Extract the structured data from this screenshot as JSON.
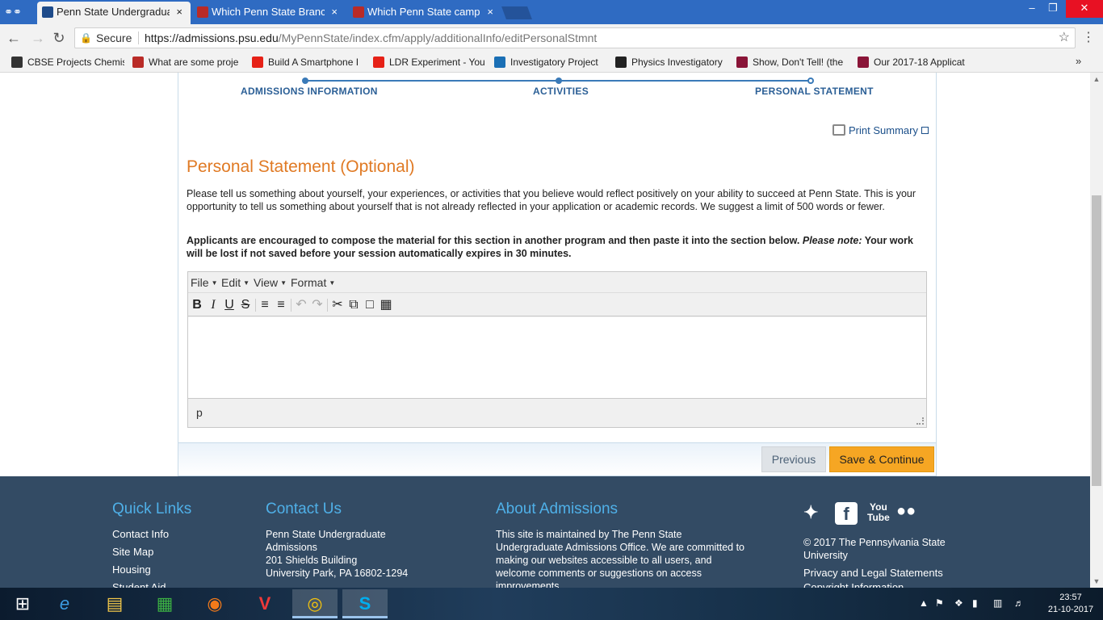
{
  "browser": {
    "incognito_icon": "incognito-icon",
    "tabs": [
      {
        "title": "Penn State Undergraduat",
        "close": "×",
        "favicon_color": "#1e4b8a",
        "active": true
      },
      {
        "title": "Which Penn State Branch",
        "close": "×",
        "favicon_color": "#b92b27",
        "active": false
      },
      {
        "title": "Which Penn State campu",
        "close": "×",
        "favicon_color": "#b92b27",
        "active": false
      }
    ],
    "window_controls": {
      "minimize": "–",
      "restore": "❐",
      "close": "✕"
    },
    "secure_label": "Secure",
    "url_host": "https://admissions.psu.edu",
    "url_path": "/MyPennState/index.cfm/apply/additionalInfo/editPersonalStmnt",
    "bookmarks": [
      {
        "label": "CBSE Projects Chemis",
        "favicon_color": "#333333"
      },
      {
        "label": "What are some proje",
        "favicon_color": "#b92b27"
      },
      {
        "label": "Build A Smartphone I",
        "favicon_color": "#e62117"
      },
      {
        "label": "LDR Experiment - You",
        "favicon_color": "#e62117"
      },
      {
        "label": "Investigatory Project",
        "favicon_color": "#1a6fb5"
      },
      {
        "label": "Physics Investigatory",
        "favicon_color": "#222222"
      },
      {
        "label": "Show, Don't Tell! (the",
        "favicon_color": "#8a1538"
      },
      {
        "label": "Our 2017-18 Applicat",
        "favicon_color": "#8a1538"
      }
    ],
    "bookmarks_more": "»"
  },
  "progress": {
    "steps": [
      "ADMISSIONS INFORMATION",
      "ACTIVITIES",
      "PERSONAL STATEMENT"
    ]
  },
  "print_summary": "Print Summary",
  "heading": "Personal Statement (Optional)",
  "intro": "Please tell us something about yourself, your experiences, or activities that you believe would reflect positively on your ability to succeed at Penn State. This is your opportunity to tell us something about yourself that is not already reflected in your application or academic records. We suggest a limit of 500 words or fewer.",
  "notice_main": "Applicants are encouraged to compose the material for this section in another program and then paste it into the section below.",
  "notice_em": "Please note:",
  "notice_end": "Your work will be lost if not saved before your session automatically expires in 30 minutes.",
  "editor": {
    "menus": [
      "File",
      "Edit",
      "View",
      "Format"
    ],
    "status_path": "p",
    "content": ""
  },
  "buttons": {
    "previous": "Previous",
    "save": "Save & Continue"
  },
  "footer": {
    "quick_links_title": "Quick Links",
    "quick_links": [
      "Contact Info",
      "Site Map",
      "Housing",
      "Student Aid"
    ],
    "contact_title": "Contact Us",
    "contact_lines": [
      "Penn State Undergraduate",
      "Admissions",
      "201 Shields Building",
      "University Park, PA 16802-1294"
    ],
    "about_title": "About Admissions",
    "about_text": "This site is maintained by The Penn State Undergraduate Admissions Office. We are committed to making our websites accessible to all users, and welcome comments or suggestions on access improvements.",
    "copyright": "© 2017 The Pennsylvania State University",
    "privacy": "Privacy and Legal Statements",
    "copyright_info": "Copyright Information",
    "social_icons": [
      "twitter-icon",
      "facebook-icon",
      "youtube-icon",
      "flickr-icon"
    ]
  },
  "taskbar": {
    "apps": [
      "start-icon",
      "internet-explorer-icon",
      "file-explorer-icon",
      "store-icon",
      "firefox-icon",
      "vivaldi-icon",
      "chrome-icon",
      "skype-icon"
    ],
    "time": "23:57",
    "date": "21-10-2017"
  }
}
